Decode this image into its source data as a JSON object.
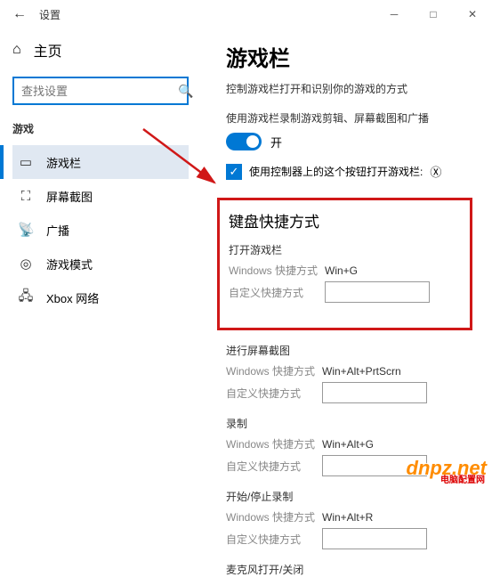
{
  "titlebar": {
    "title": "设置"
  },
  "sidebar": {
    "home": "主页",
    "search_placeholder": "查找设置",
    "section": "游戏",
    "items": [
      {
        "label": "游戏栏"
      },
      {
        "label": "屏幕截图"
      },
      {
        "label": "广播"
      },
      {
        "label": "游戏模式"
      },
      {
        "label": "Xbox 网络"
      }
    ]
  },
  "content": {
    "title": "游戏栏",
    "desc": "控制游戏栏打开和识别你的游戏的方式",
    "toggle_desc": "使用游戏栏录制游戏剪辑、屏幕截图和广播",
    "toggle_label": "开",
    "checkbox_label": "使用控制器上的这个按钮打开游戏栏:",
    "shortcuts_heading": "键盘快捷方式",
    "groups": [
      {
        "title": "打开游戏栏",
        "win_label": "Windows 快捷方式",
        "win_value": "Win+G",
        "custom_label": "自定义快捷方式"
      },
      {
        "title": "进行屏幕截图",
        "win_label": "Windows 快捷方式",
        "win_value": "Win+Alt+PrtScrn",
        "custom_label": "自定义快捷方式"
      },
      {
        "title": "录制",
        "win_label": "Windows 快捷方式",
        "win_value": "Win+Alt+G",
        "custom_label": "自定义快捷方式"
      },
      {
        "title": "开始/停止录制",
        "win_label": "Windows 快捷方式",
        "win_value": "Win+Alt+R",
        "custom_label": "自定义快捷方式"
      },
      {
        "title": "麦克风打开/关闭"
      }
    ]
  },
  "watermark": {
    "text": "dnpz",
    "suffix": ".net",
    "sub": "电脑配置网"
  }
}
